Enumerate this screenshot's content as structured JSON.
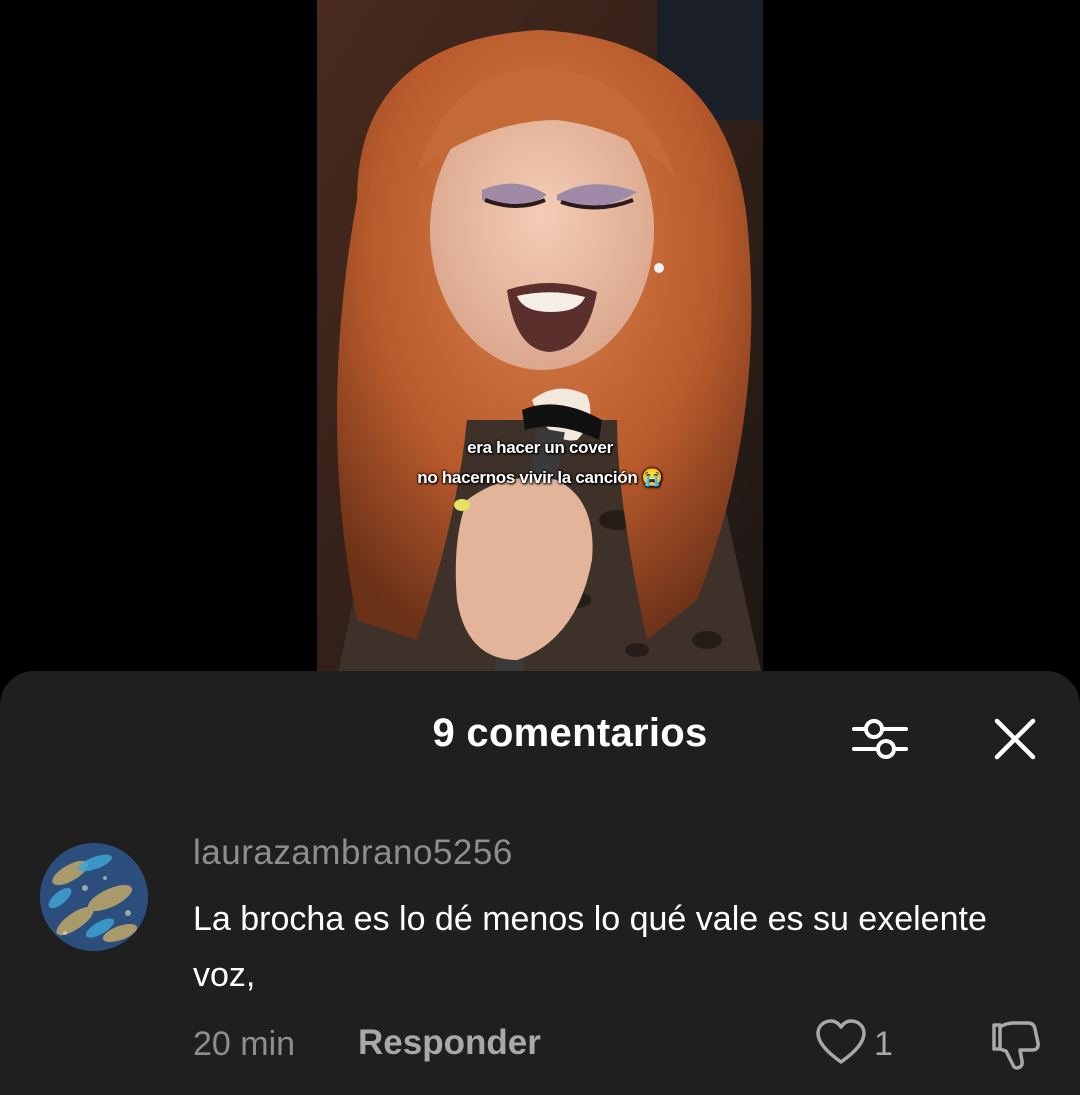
{
  "video": {
    "caption_line1": "era hacer un cover",
    "caption_line2": "no hacernos vivir la canción 😭"
  },
  "comments_sheet": {
    "title": "9 comentarios",
    "icons": {
      "filter": "sliders-icon",
      "close": "close-icon"
    },
    "comments": [
      {
        "username": "laurazambrano5256",
        "text": "La brocha es lo dé menos lo qué vale es su exelente voz,",
        "time": "20 min",
        "reply_label": "Responder",
        "like_count": "1"
      }
    ]
  },
  "colors": {
    "sheet_bg": "#1f1f1f",
    "text_primary": "#ffffff",
    "text_secondary": "#8e8e8e"
  }
}
